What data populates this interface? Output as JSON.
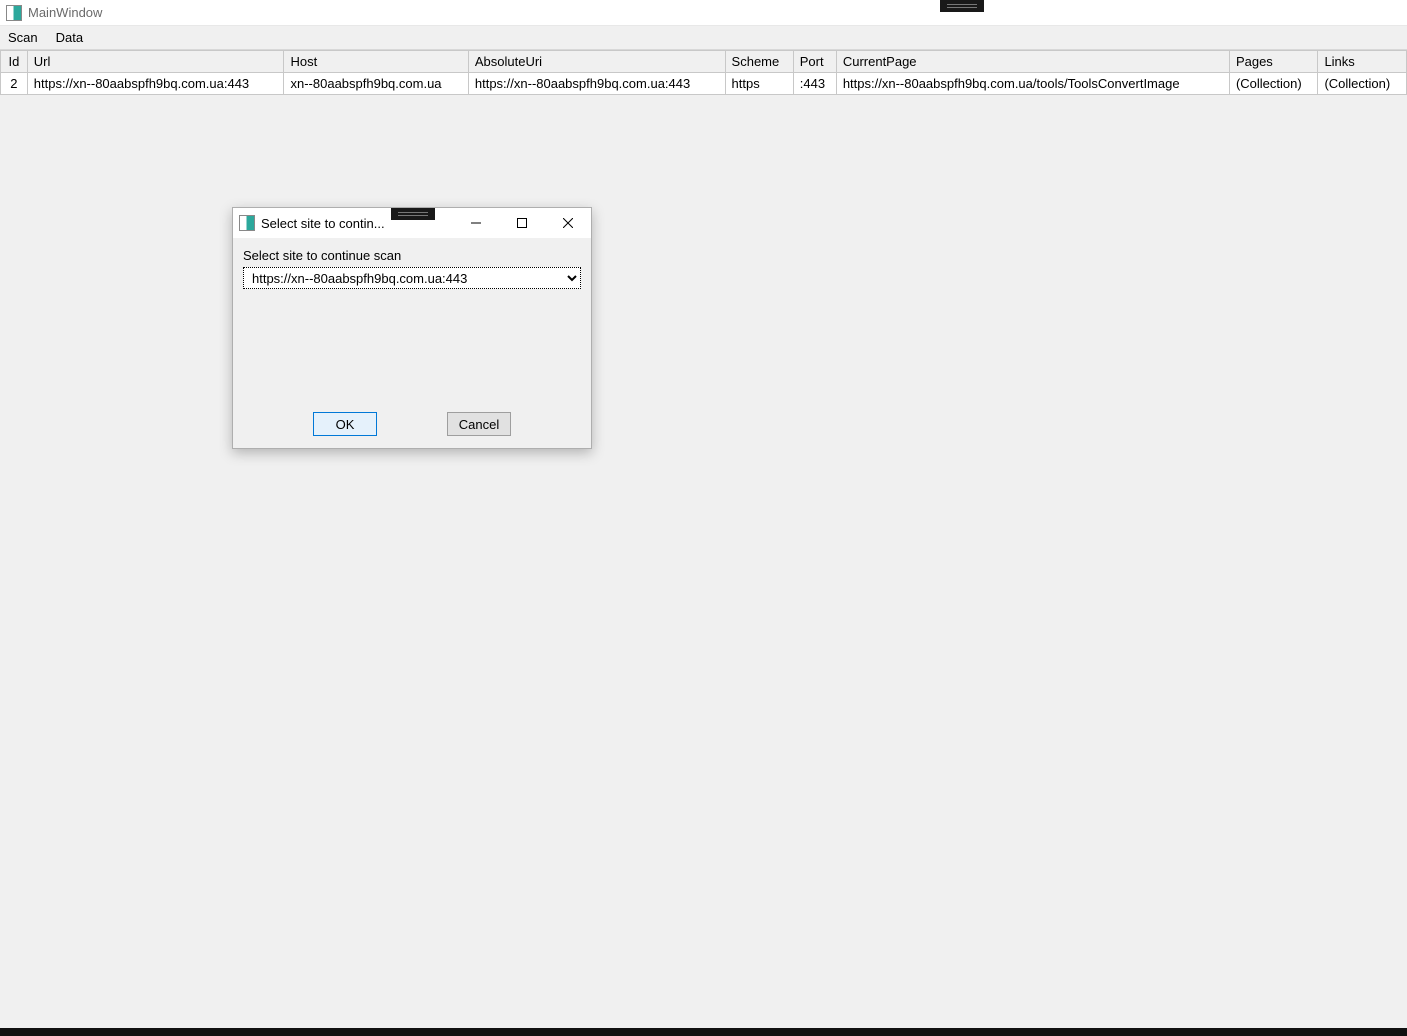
{
  "window": {
    "title": "MainWindow"
  },
  "menu": {
    "items": [
      "Scan",
      "Data"
    ]
  },
  "grid": {
    "columns": [
      "Id",
      "Url",
      "Host",
      "AbsoluteUri",
      "Scheme",
      "Port",
      "CurrentPage",
      "Pages",
      "Links"
    ],
    "rows": [
      {
        "Id": "2",
        "Url": "https://xn--80aabspfh9bq.com.ua:443",
        "Host": "xn--80aabspfh9bq.com.ua",
        "AbsoluteUri": "https://xn--80aabspfh9bq.com.ua:443",
        "Scheme": "https",
        "Port": ":443",
        "CurrentPage": "https://xn--80aabspfh9bq.com.ua/tools/ToolsConvertImage",
        "Pages": "(Collection)",
        "Links": "(Collection)"
      }
    ]
  },
  "dialog": {
    "title": "Select site to contin...",
    "label": "Select site to continue scan",
    "selected": "https://xn--80aabspfh9bq.com.ua:443",
    "ok_label": "OK",
    "cancel_label": "Cancel"
  }
}
